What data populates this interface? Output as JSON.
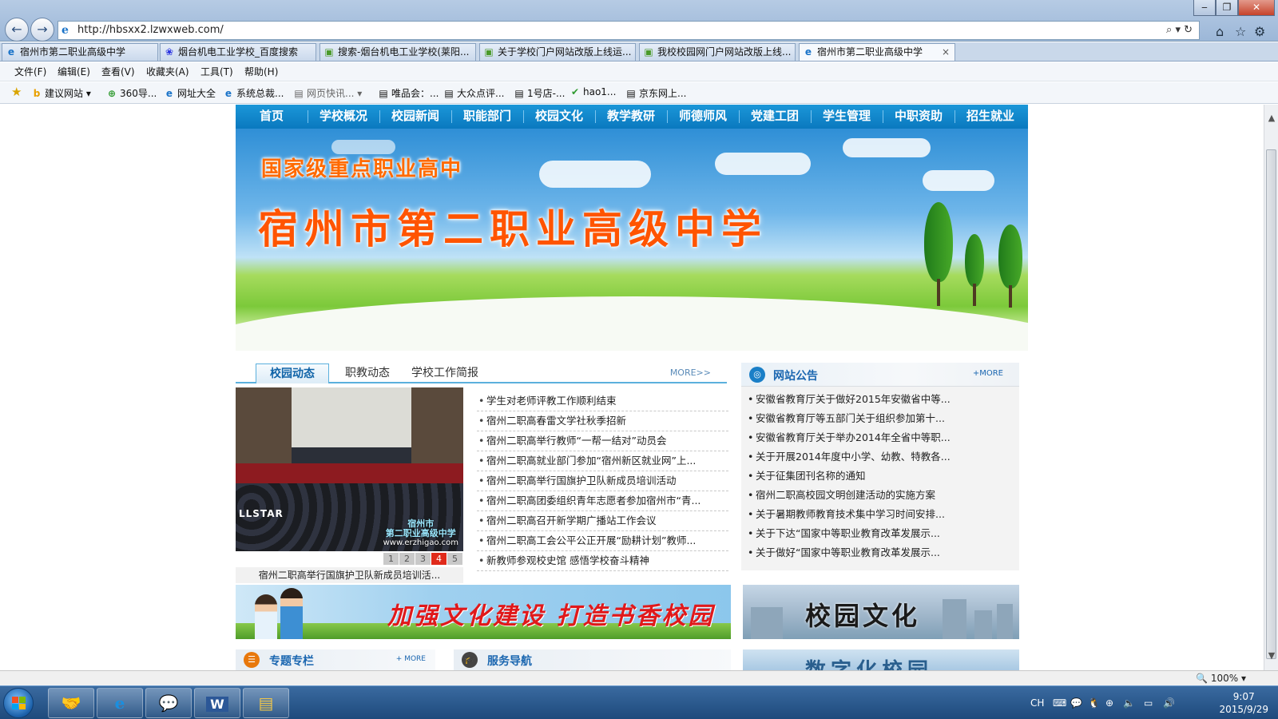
{
  "browser": {
    "url": "http://hbsxx2.lzwxweb.com/",
    "back_icon": "back-arrow",
    "forward_icon": "forward-arrow",
    "address_tools": "⌕ ▾ ↻",
    "tabs": [
      {
        "label": "宿州市第二职业高级中学",
        "icon": "ie-page"
      },
      {
        "label": "烟台机电工业学校_百度搜索",
        "icon": "baidu-paw"
      },
      {
        "label": "搜索-烟台机电工业学校(莱阳...",
        "icon": "page"
      },
      {
        "label": "关于学校门户网站改版上线运...",
        "icon": "page"
      },
      {
        "label": "我校校园网门户网站改版上线...",
        "icon": "page"
      },
      {
        "label": "宿州市第二职业高级中学",
        "icon": "ie-page",
        "active": true
      }
    ],
    "tab_close": "×",
    "menu": [
      "文件(F)",
      "编辑(E)",
      "查看(V)",
      "收藏夹(A)",
      "工具(T)",
      "帮助(H)"
    ],
    "favorites": [
      "建议网站 ▾",
      "360导...",
      "网址大全",
      "系统总裁...",
      "网页快讯... ▾",
      "唯品会：...",
      "大众点评...",
      "1号店-...",
      "hao1...",
      "京东网上..."
    ],
    "zoom": "100%"
  },
  "site": {
    "nav": [
      "首页",
      "学校概况",
      "校园新闻",
      "职能部门",
      "校园文化",
      "教学教研",
      "师德师风",
      "党建工团",
      "学生管理",
      "中职资助",
      "招生就业"
    ],
    "banner_subtitle": "国家级重点职业高中",
    "banner_title": "宿州市第二职业高级中学",
    "news_tabs": [
      "校园动态",
      "职教动态",
      "学校工作简报"
    ],
    "news_more": "MORE>>",
    "photo_watermark_1": "宿州市",
    "photo_watermark_2": "第二职业高级中学",
    "photo_watermark_3": "www.erzhigao.com",
    "photo_star": "LLSTAR",
    "pager": [
      "1",
      "2",
      "3",
      "4",
      "5"
    ],
    "pager_active": 4,
    "photo_caption": "宿州二职高举行国旗护卫队新成员培训活...",
    "news_items": [
      "学生对老师评教工作顺利结束",
      "宿州二职高春雷文学社秋季招新",
      "宿州二职高举行教师“一帮一结对”动员会",
      "宿州二职高就业部门参加“宿州新区就业网”上...",
      "宿州二职高举行国旗护卫队新成员培训活动",
      "宿州二职高团委组织青年志愿者参加宿州市“青...",
      "宿州二职高召开新学期广播站工作会议",
      "宿州二职高工会公平公正开展“励耕计划”教师...",
      "新教师参观校史馆 感悟学校奋斗精神"
    ],
    "notice_title": "网站公告",
    "notice_more": "+MORE",
    "notice_items": [
      "安徽省教育厅关于做好2015年安徽省中等...",
      "安徽省教育厅等五部门关于组织参加第十...",
      "安徽省教育厅关于举办2014年全省中等职...",
      "关于开展2014年度中小学、幼教、特教各...",
      "关于征集团刊名称的通知",
      "宿州二职高校园文明创建活动的实施方案",
      "关于暑期教师教育技术集中学习时间安排...",
      "关于下达“国家中等职业教育改革发展示...",
      "关于做好“国家中等职业教育改革发展示..."
    ],
    "side_float": "54",
    "promo_text": "加强文化建设  打造书香校园",
    "culture_text": "校园文化",
    "special_title": "专题专栏",
    "special_more": "+ MORE",
    "service_title": "服务导航",
    "digital_text": "数字化校园"
  },
  "taskbar": {
    "tray_lang": "CH",
    "time": "9:07",
    "date": "2015/9/29"
  },
  "colors": {
    "nav_bg": "#0a79bf",
    "accent_orange": "#ff5400",
    "link_blue": "#1a66b0",
    "pager_active": "#e02a1a",
    "promo_red": "#e0191b"
  }
}
